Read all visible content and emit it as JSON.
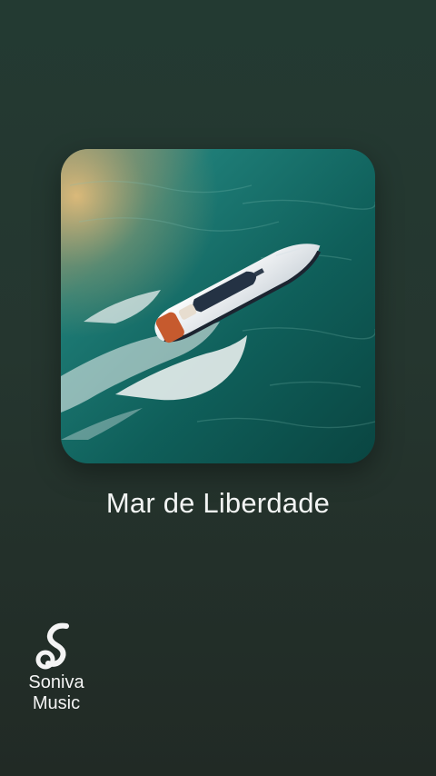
{
  "player": {
    "song_title": "Mar de Liberdade",
    "artwork_icon": "speedboat-ocean-artwork"
  },
  "brand": {
    "logo_icon": "music-note-s-logo",
    "name_line1": "Soniva",
    "name_line2": "Music"
  },
  "colors": {
    "background_top": "#233a32",
    "background_bottom": "#212a25",
    "sea": "#0f5a55",
    "text": "#f2f4f3"
  }
}
